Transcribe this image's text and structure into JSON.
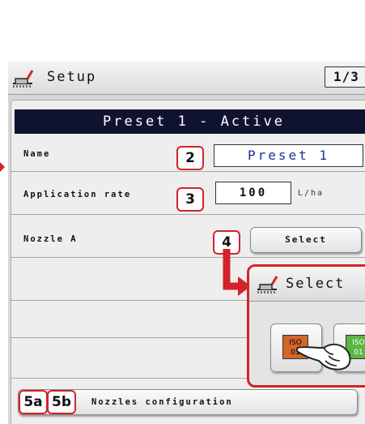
{
  "window": {
    "title": "Setup",
    "page_indicator": "1/3"
  },
  "preset": {
    "banner": "Preset 1 - Active"
  },
  "fields": {
    "name_label": "Name",
    "name_value": "Preset 1",
    "rate_label": "Application rate",
    "rate_value": "100",
    "rate_unit": "L/ha",
    "nozzle_label": "Nozzle A",
    "select_label": "Select"
  },
  "nozzles_config": {
    "label": "Nozzles configuration"
  },
  "callouts": {
    "c2": "2",
    "c3": "3",
    "c4": "4",
    "c5a": "5a",
    "c5b": "5b"
  },
  "select_popup": {
    "title": "Select",
    "options": [
      {
        "line1": "ISO",
        "line2": "01",
        "color": "#d2662b"
      },
      {
        "line1": "ISO",
        "line2": "01",
        "color": "#5bb543"
      }
    ]
  },
  "colors": {
    "accent": "#d5222a",
    "banner": "#0f1330",
    "value_text": "#1f2f9a"
  }
}
